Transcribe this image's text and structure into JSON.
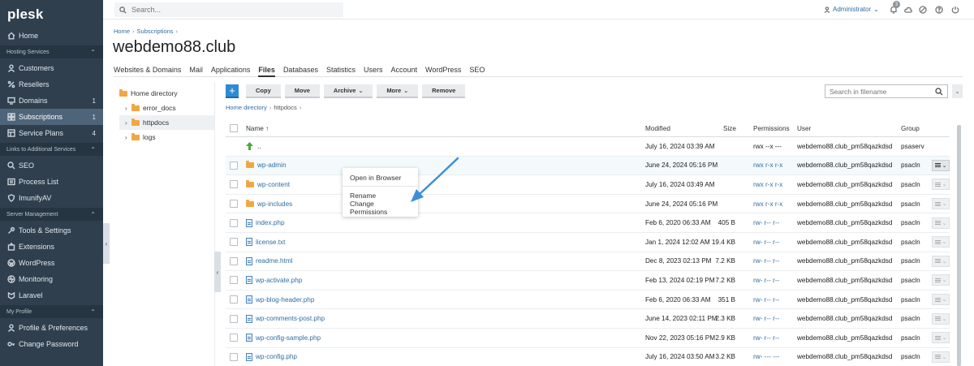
{
  "brand": "plesk",
  "colors": {
    "sidebar_bg": "#2f3f4e",
    "accent": "#2d8bd4",
    "folder": "#f1a741",
    "link": "#2f6da3",
    "arrow": "#3f8fd8"
  },
  "sidebar": {
    "items_main": [
      {
        "label": "Home",
        "icon": "home-icon",
        "count": ""
      }
    ],
    "section_hosting": "Hosting Services",
    "items_hosting": [
      {
        "label": "Customers",
        "icon": "user-icon",
        "count": ""
      },
      {
        "label": "Resellers",
        "icon": "percent-icon",
        "count": ""
      },
      {
        "label": "Domains",
        "icon": "monitor-icon",
        "count": "1"
      },
      {
        "label": "Subscriptions",
        "icon": "grid-icon",
        "count": "1"
      },
      {
        "label": "Service Plans",
        "icon": "plans-icon",
        "count": "4"
      }
    ],
    "section_links": "Links to Additional Services",
    "items_links": [
      {
        "label": "SEO",
        "icon": "seo-icon",
        "count": ""
      },
      {
        "label": "Process List",
        "icon": "process-icon",
        "count": ""
      },
      {
        "label": "ImunifyAV",
        "icon": "shield-icon",
        "count": ""
      }
    ],
    "section_server": "Server Management",
    "items_server": [
      {
        "label": "Tools & Settings",
        "icon": "tools-icon",
        "count": ""
      },
      {
        "label": "Extensions",
        "icon": "extensions-icon",
        "count": ""
      },
      {
        "label": "WordPress",
        "icon": "wordpress-icon",
        "count": ""
      },
      {
        "label": "Monitoring",
        "icon": "monitoring-icon",
        "count": ""
      },
      {
        "label": "Laravel",
        "icon": "laravel-icon",
        "count": ""
      }
    ],
    "section_profile": "My Profile",
    "items_profile": [
      {
        "label": "Profile & Preferences",
        "icon": "profile-icon",
        "count": ""
      },
      {
        "label": "Change Password",
        "icon": "key-icon",
        "count": ""
      }
    ]
  },
  "topbar": {
    "search_placeholder": "Search...",
    "user": "Administrator",
    "notifications_count": "3"
  },
  "breadcrumb": {
    "home": "Home",
    "subscriptions": "Subscriptions"
  },
  "page_title": "webdemo88.club",
  "tabs": [
    "Websites & Domains",
    "Mail",
    "Applications",
    "Files",
    "Databases",
    "Statistics",
    "Users",
    "Account",
    "WordPress",
    "SEO"
  ],
  "active_tab": "Files",
  "tree": {
    "root": "Home directory",
    "children": [
      "error_docs",
      "httpdocs",
      "logs"
    ]
  },
  "toolbar": {
    "plus": "+",
    "copy": "Copy",
    "move": "Move",
    "archive": "Archive",
    "more": "More",
    "remove": "Remove",
    "filename_search_placeholder": "Search in filename"
  },
  "path": {
    "home": "Home directory",
    "current": "httpdocs"
  },
  "table": {
    "headers": {
      "name": "Name ↑",
      "modified": "Modified",
      "size": "Size",
      "permissions": "Permissions",
      "user": "User",
      "group": "Group"
    },
    "rows": [
      {
        "name": "..",
        "type": "up",
        "modified": "July 16, 2024 03:39 AM",
        "size": "",
        "perm": "rwx --x ---",
        "user": "webdemo88.club_pm58qazkdsd",
        "group": "psaserv"
      },
      {
        "name": "wp-admin",
        "type": "folder",
        "modified": "June 24, 2024 05:16 PM",
        "size": "",
        "perm": "rwx r-x r-x",
        "user": "webdemo88.club_pm58qazkdsd",
        "group": "psacln"
      },
      {
        "name": "wp-content",
        "type": "folder",
        "modified": "July 16, 2024 03:49 AM",
        "size": "",
        "perm": "rwx r-x r-x",
        "user": "webdemo88.club_pm58qazkdsd",
        "group": "psacln"
      },
      {
        "name": "wp-includes",
        "type": "folder",
        "modified": "June 24, 2024 05:16 PM",
        "size": "",
        "perm": "rwx r-x r-x",
        "user": "webdemo88.club_pm58qazkdsd",
        "group": "psacln"
      },
      {
        "name": "index.php",
        "type": "file",
        "modified": "Feb 6, 2020 06:33 AM",
        "size": "405 B",
        "perm": "rw- r-- r--",
        "user": "webdemo88.club_pm58qazkdsd",
        "group": "psacln"
      },
      {
        "name": "license.txt",
        "type": "file",
        "modified": "Jan 1, 2024 12:02 AM",
        "size": "19.4 KB",
        "perm": "rw- r-- r--",
        "user": "webdemo88.club_pm58qazkdsd",
        "group": "psacln"
      },
      {
        "name": "readme.html",
        "type": "file",
        "modified": "Dec 8, 2023 02:13 PM",
        "size": "7.2 KB",
        "perm": "rw- r-- r--",
        "user": "webdemo88.club_pm58qazkdsd",
        "group": "psacln"
      },
      {
        "name": "wp-activate.php",
        "type": "file",
        "modified": "Feb 13, 2024 02:19 PM",
        "size": "7.2 KB",
        "perm": "rw- r-- r--",
        "user": "webdemo88.club_pm58qazkdsd",
        "group": "psacln"
      },
      {
        "name": "wp-blog-header.php",
        "type": "file",
        "modified": "Feb 6, 2020 06:33 AM",
        "size": "351 B",
        "perm": "rw- r-- r--",
        "user": "webdemo88.club_pm58qazkdsd",
        "group": "psacln"
      },
      {
        "name": "wp-comments-post.php",
        "type": "file",
        "modified": "June 14, 2023 02:11 PM",
        "size": "2.3 KB",
        "perm": "rw- r-- r--",
        "user": "webdemo88.club_pm58qazkdsd",
        "group": "psacln"
      },
      {
        "name": "wp-config-sample.php",
        "type": "file",
        "modified": "Nov 22, 2023 05:16 PM",
        "size": "2.9 KB",
        "perm": "rw- r-- r--",
        "user": "webdemo88.club_pm58qazkdsd",
        "group": "psacln"
      },
      {
        "name": "wp-config.php",
        "type": "file",
        "modified": "July 16, 2024 03:50 AM",
        "size": "3.2 KB",
        "perm": "rw- --- ---",
        "user": "webdemo88.club_pm58qazkdsd",
        "group": "psacln"
      }
    ]
  },
  "context_menu": [
    "Open in Browser",
    "Rename",
    "Change Permissions"
  ]
}
